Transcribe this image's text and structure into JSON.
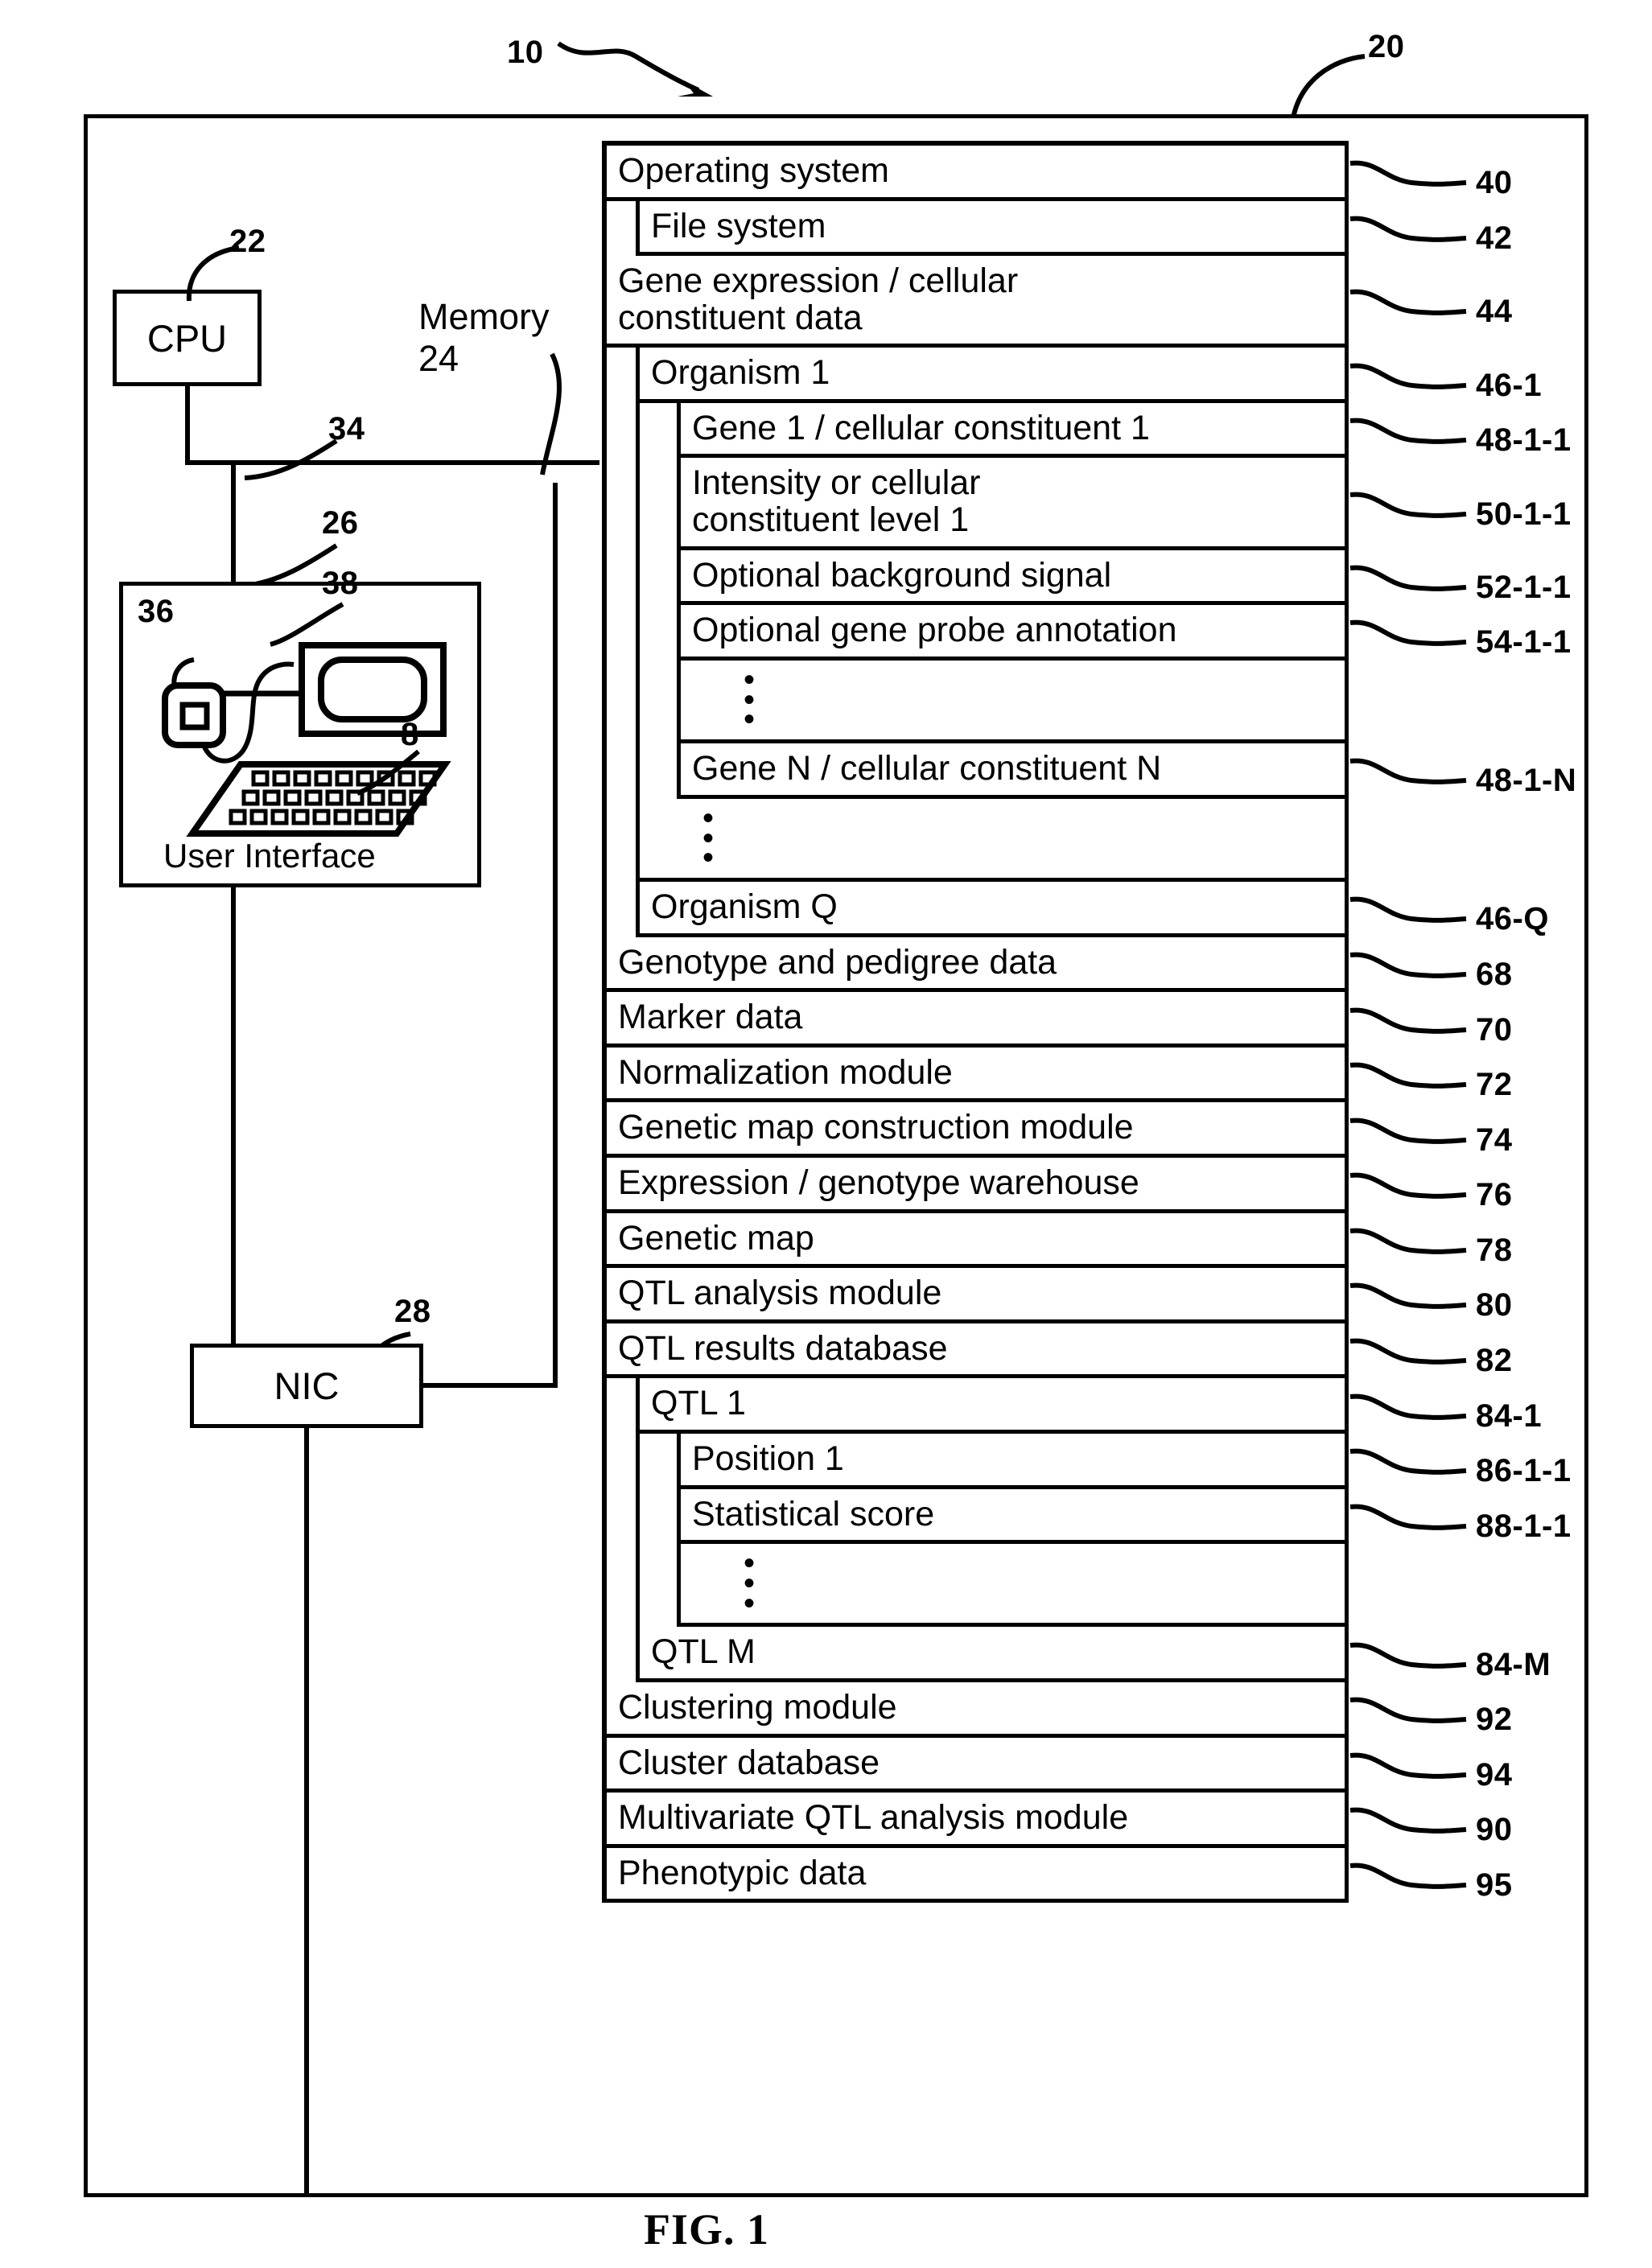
{
  "figure": {
    "caption": "FIG. 1",
    "system_ref": "10",
    "computer_ref": "20"
  },
  "hardware": {
    "cpu": {
      "label": "CPU",
      "ref": "22"
    },
    "nic": {
      "label": "NIC",
      "ref": "28"
    },
    "bus_ref": "34",
    "memory": {
      "label_line1": "Memory",
      "label_line2": "24"
    },
    "user_interface": {
      "label": "User Interface",
      "ref": "26",
      "mouse_ref": "36",
      "display_ref": "38",
      "keyboard_ref": "8"
    }
  },
  "memory_rows": [
    {
      "id": "operating-system",
      "text": "Operating system",
      "ref": "40",
      "indent": 0
    },
    {
      "id": "file-system",
      "text": "File system",
      "ref": "42",
      "indent": 1
    },
    {
      "id": "gene-expression-data",
      "text": "Gene expression / cellular\nconstituent data",
      "ref": "44",
      "indent": 0
    },
    {
      "id": "organism-1",
      "text": "Organism 1",
      "ref": "46-1",
      "indent": 1
    },
    {
      "id": "gene-1",
      "text": "Gene 1 / cellular constituent 1",
      "ref": "48-1-1",
      "indent": 2
    },
    {
      "id": "intensity-level-1",
      "text": "Intensity or cellular\nconstituent level 1",
      "ref": "50-1-1",
      "indent": 2
    },
    {
      "id": "optional-background",
      "text": "Optional background signal",
      "ref": "52-1-1",
      "indent": 2
    },
    {
      "id": "optional-annotation",
      "text": "Optional gene probe annotation",
      "ref": "54-1-1",
      "indent": 2
    },
    {
      "id": "gene-n",
      "text": "Gene N / cellular constituent N",
      "ref": "48-1-N",
      "indent": 2
    },
    {
      "id": "organism-q",
      "text": "Organism Q",
      "ref": "46-Q",
      "indent": 1
    },
    {
      "id": "genotype-pedigree",
      "text": "Genotype and pedigree data",
      "ref": "68",
      "indent": 0
    },
    {
      "id": "marker-data",
      "text": "Marker data",
      "ref": "70",
      "indent": 0
    },
    {
      "id": "normalization-module",
      "text": "Normalization module",
      "ref": "72",
      "indent": 0
    },
    {
      "id": "genetic-map-construction",
      "text": "Genetic map construction module",
      "ref": "74",
      "indent": 0
    },
    {
      "id": "expression-warehouse",
      "text": "Expression / genotype warehouse",
      "ref": "76",
      "indent": 0
    },
    {
      "id": "genetic-map",
      "text": "Genetic map",
      "ref": "78",
      "indent": 0
    },
    {
      "id": "qtl-analysis-module",
      "text": "QTL analysis module",
      "ref": "80",
      "indent": 0
    },
    {
      "id": "qtl-results-database",
      "text": "QTL results database",
      "ref": "82",
      "indent": 0
    },
    {
      "id": "qtl-1",
      "text": "QTL 1",
      "ref": "84-1",
      "indent": 1
    },
    {
      "id": "position-1",
      "text": "Position 1",
      "ref": "86-1-1",
      "indent": 2
    },
    {
      "id": "statistical-score",
      "text": "Statistical score",
      "ref": "88-1-1",
      "indent": 2
    },
    {
      "id": "qtl-m",
      "text": "QTL M",
      "ref": "84-M",
      "indent": 1
    },
    {
      "id": "clustering-module",
      "text": "Clustering module",
      "ref": "92",
      "indent": 0
    },
    {
      "id": "cluster-database",
      "text": "Cluster database",
      "ref": "94",
      "indent": 0
    },
    {
      "id": "multivariate-qtl-module",
      "text": "Multivariate QTL analysis module",
      "ref": "90",
      "indent": 0
    },
    {
      "id": "phenotypic-data",
      "text": "Phenotypic data",
      "ref": "95",
      "indent": 0
    }
  ],
  "ellipsis_glyph": "•"
}
